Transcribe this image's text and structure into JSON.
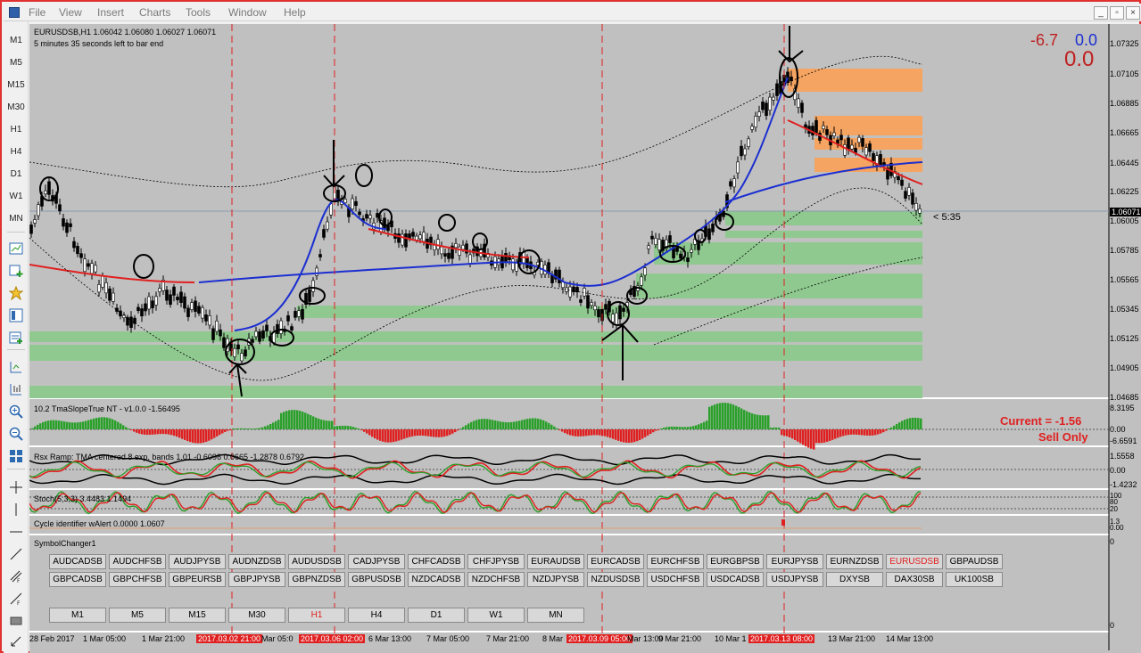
{
  "menubar": {
    "items": [
      "File",
      "View",
      "Insert",
      "Charts",
      "Tools",
      "Window",
      "Help"
    ]
  },
  "toolbar": {
    "timeframes": [
      "M1",
      "M5",
      "M15",
      "M30",
      "H1",
      "H4",
      "D1",
      "W1",
      "MN"
    ]
  },
  "chart": {
    "header": "EURUSDSB,H1  1.06042 1.06080 1.06027 1.06071",
    "countdown": "5 minutes 35 seconds left to bar end",
    "top_left_value": "-6.7",
    "top_right_value": "0.0",
    "top_big_value": "0.0",
    "timer_label": "< 5:35",
    "current_price": "1.06071",
    "price_levels": [
      "1.07325",
      "1.07105",
      "1.06885",
      "1.06665",
      "1.06445",
      "1.06225",
      "1.06071",
      "1.06005",
      "1.05785",
      "1.05565",
      "1.05345",
      "1.05125",
      "1.04905",
      "1.04685"
    ],
    "colors": {
      "up": "#2aa02a",
      "down": "#e02020",
      "ma_red": "#e02020",
      "ma_blue": "#1c2fd0",
      "zone_green": "#8fc98f",
      "zone_orange": "#f5a462",
      "vline": "#e02020"
    }
  },
  "sub1": {
    "title": "10.2 TmaSlopeTrue NT  -  v1.0.0     -1.56495",
    "current": "Current = -1.56",
    "signal": "Sell Only",
    "axis": [
      "8.3195",
      "0.00",
      "-6.6591"
    ]
  },
  "sub2": {
    "title": "Rsx Ramp: TMA centered 8 exp. bands 1.01 -0.6096 0.0665 -1.2878 0.6792",
    "axis": [
      "1.5558",
      "0.00",
      "-1.4232"
    ]
  },
  "sub3": {
    "title": "Stoch(5,3,3) 3.4483 1.1494",
    "axis": [
      "100",
      "80",
      "20",
      "0"
    ]
  },
  "sub4": {
    "title": "Cycle identifier wAlert 0.0000 1.0607",
    "axis": [
      "1.3",
      "0.00"
    ]
  },
  "symbol_changer": {
    "title": "SymbolChanger1",
    "row1": [
      "AUDCADSB",
      "AUDCHFSB",
      "AUDJPYSB",
      "AUDNZDSB",
      "AUDUSDSB",
      "CADJPYSB",
      "CHFCADSB",
      "CHFJPYSB",
      "EURAUDSB",
      "EURCADSB",
      "EURCHFSB",
      "EURGBPSB",
      "EURJPYSB",
      "EURNZDSB",
      "EURUSDSB",
      "GBPAUDSB"
    ],
    "row2": [
      "GBPCADSB",
      "GBPCHFSB",
      "GBPEURSB",
      "GBPJPYSB",
      "GBPNZDSB",
      "GBPUSDSB",
      "NZDCADSB",
      "NZDCHFSB",
      "NZDJPYSB",
      "NZDUSDSB",
      "USDCHFSB",
      "USDCADSB",
      "USDJPYSB",
      "DXYSB",
      "DAX30SB",
      "UK100SB"
    ],
    "active_symbol": "EURUSDSB",
    "timeframes": [
      "M1",
      "M5",
      "M15",
      "M30",
      "H1",
      "H4",
      "D1",
      "W1",
      "MN"
    ],
    "active_timeframe": "H1",
    "axis": [
      "0",
      "0"
    ]
  },
  "xaxis": {
    "labels": [
      "28 Feb 2017",
      "1 Mar 05:00",
      "1 Mar 21:00",
      "2017.03.02 21:00",
      "Mar 05:0",
      "2017.03.06 02:00",
      "6 Mar 13:00",
      "7 Mar 05:00",
      "7 Mar 21:00",
      "8 Mar",
      "2017.03.09 05:00",
      "Mar 13:00",
      "9 Mar 21:00",
      "10 Mar 1",
      "2017.03.13 08:00",
      "13 Mar 21:00",
      "14 Mar 13:00"
    ]
  }
}
